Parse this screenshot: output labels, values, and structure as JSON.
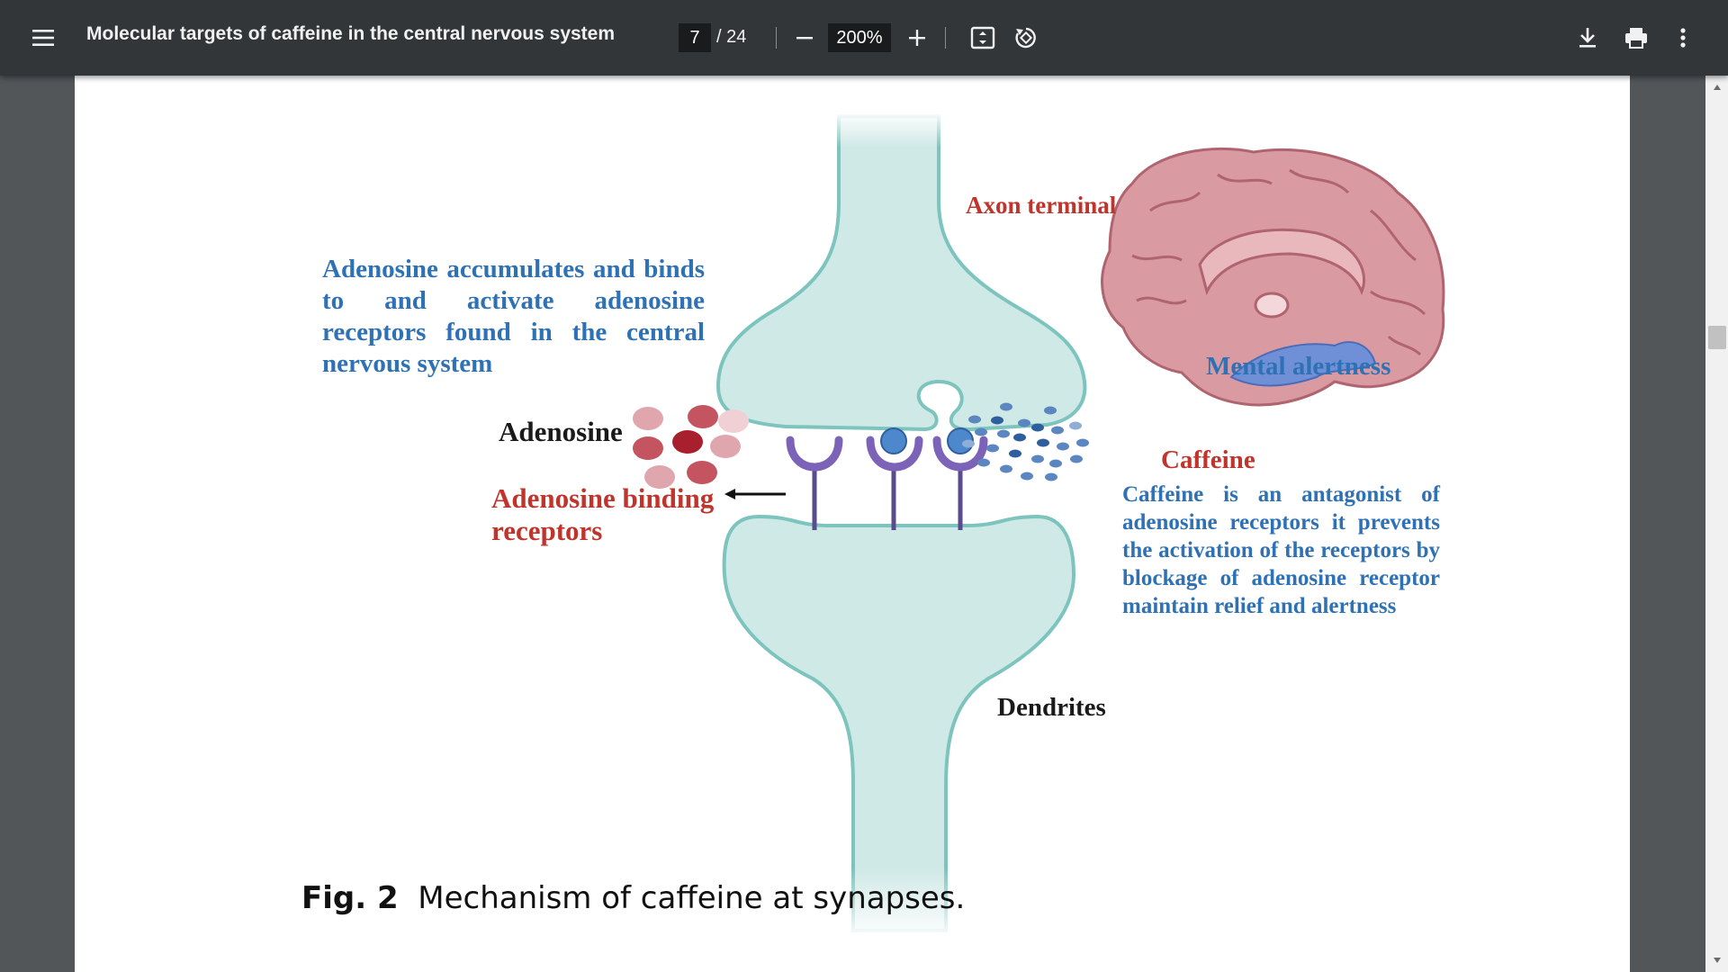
{
  "toolbar": {
    "title": "Molecular targets of caffeine in the central nervous system",
    "page_current": "7",
    "page_total": "/ 24",
    "zoom": "200%",
    "icons": [
      "menu-icon",
      "zoom-out-icon",
      "zoom-in-icon",
      "fit-page-icon",
      "rotate-icon",
      "download-icon",
      "print-icon",
      "more-icon"
    ]
  },
  "figure": {
    "label_axon": "Axon terminal",
    "label_mental": "Mental alertness",
    "adenosine_paragraph": "Adenosine accumulates and binds to and activate adenosine receptors found in the central nervous system",
    "label_adenosine": "Adenosine",
    "label_binding_line1": "Adenosine binding",
    "label_binding_line2": "receptors",
    "label_caffeine": "Caffeine",
    "caffeine_paragraph": "Caffeine is an antagonist of adenosine receptors it prevents the activation of the receptors by blockage of adenosine receptor maintain relief and alertness",
    "label_dendrites": "Dendrites"
  },
  "caption": {
    "label": "Fig. 2",
    "text": "Mechanism of caffeine at synapses."
  },
  "colors": {
    "toolbar_bg": "#323639",
    "viewer_bg": "#525659",
    "neuron_fill": "#cfe9e6",
    "neuron_stroke": "#7cc4bd",
    "text_blue": "#2e72b5",
    "text_red": "#c0342c",
    "receptor_purple": "#5a4b8c",
    "caffeine_blue": "#5c86c0",
    "brain_pink": "#c47a84"
  }
}
